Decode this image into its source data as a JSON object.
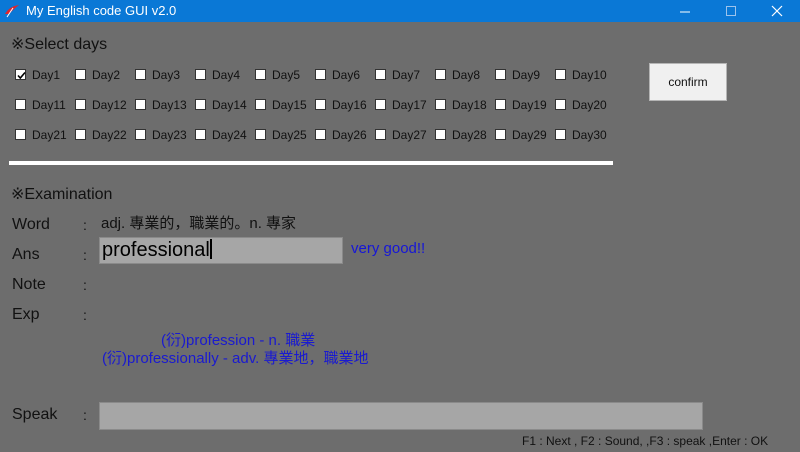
{
  "window": {
    "title": "My English code GUI v2.0",
    "app_icon": "tk-feather-icon",
    "accent_color": "#0a78d6"
  },
  "select_days": {
    "title": "※Select days",
    "days": [
      {
        "label": "Day1",
        "checked": true
      },
      {
        "label": "Day2",
        "checked": false
      },
      {
        "label": "Day3",
        "checked": false
      },
      {
        "label": "Day4",
        "checked": false
      },
      {
        "label": "Day5",
        "checked": false
      },
      {
        "label": "Day6",
        "checked": false
      },
      {
        "label": "Day7",
        "checked": false
      },
      {
        "label": "Day8",
        "checked": false
      },
      {
        "label": "Day9",
        "checked": false
      },
      {
        "label": "Day10",
        "checked": false
      },
      {
        "label": "Day11",
        "checked": false
      },
      {
        "label": "Day12",
        "checked": false
      },
      {
        "label": "Day13",
        "checked": false
      },
      {
        "label": "Day14",
        "checked": false
      },
      {
        "label": "Day15",
        "checked": false
      },
      {
        "label": "Day16",
        "checked": false
      },
      {
        "label": "Day17",
        "checked": false
      },
      {
        "label": "Day18",
        "checked": false
      },
      {
        "label": "Day19",
        "checked": false
      },
      {
        "label": "Day20",
        "checked": false
      },
      {
        "label": "Day21",
        "checked": false
      },
      {
        "label": "Day22",
        "checked": false
      },
      {
        "label": "Day23",
        "checked": false
      },
      {
        "label": "Day24",
        "checked": false
      },
      {
        "label": "Day25",
        "checked": false
      },
      {
        "label": "Day26",
        "checked": false
      },
      {
        "label": "Day27",
        "checked": false
      },
      {
        "label": "Day28",
        "checked": false
      },
      {
        "label": "Day29",
        "checked": false
      },
      {
        "label": "Day30",
        "checked": false
      }
    ],
    "confirm_label": "confirm"
  },
  "examination": {
    "title": "※Examination",
    "colon": ":",
    "word_label": "Word",
    "word_value": "adj. 專業的，職業的。n. 專家",
    "ans_label": "Ans",
    "ans_value": "professional",
    "feedback": "very good!!",
    "feedback_color": "#1616d8",
    "note_label": "Note",
    "exp_label": "Exp",
    "exp_lines": [
      "(衍)profession - n. 職業",
      "(衍)professionally - adv. 專業地，職業地"
    ],
    "speak_label": "Speak",
    "speak_value": ""
  },
  "hint": "F1 : Next , F2 : Sound, ,F3 : speak ,Enter : OK"
}
